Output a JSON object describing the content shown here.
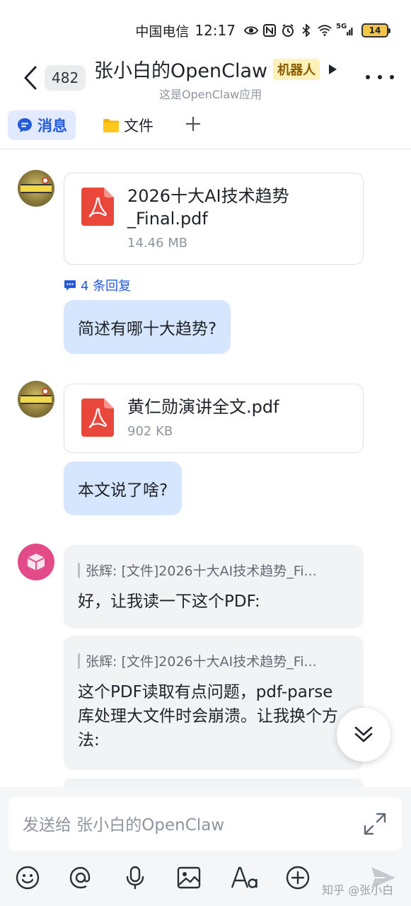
{
  "status_bar": {
    "carrier": "中国电信",
    "time": "12:17",
    "battery": "14",
    "network": "5G",
    "icons": [
      "eye-icon",
      "nfc-icon",
      "alarm-icon",
      "bluetooth-icon",
      "wifi-icon",
      "signal-icon",
      "battery-icon"
    ]
  },
  "header": {
    "unread_count": "482",
    "title": "张小白的OpenClaw",
    "badge": "机器人",
    "subtitle": "这是OpenClaw应用"
  },
  "tabs": [
    {
      "label": "消息",
      "icon": "chat-bubble-icon",
      "active": true
    },
    {
      "label": "文件",
      "icon": "folder-icon",
      "active": false
    }
  ],
  "messages": {
    "file1": {
      "name": "2026十大AI技术趋势_Final.pdf",
      "size": "14.46 MB"
    },
    "reply_count": "4 条回复",
    "question1": "简述有哪十大趋势?",
    "file2": {
      "name": "黄仁勋演讲全文.pdf",
      "size": "902 KB"
    },
    "question2": "本文说了啥?",
    "bot_reply1": {
      "quote": "张辉: [文件]2026十大AI技术趋势_Fi...",
      "text": "好，让我读一下这个PDF:"
    },
    "bot_reply2": {
      "quote": "张辉: [文件]2026十大AI技术趋势_Fi...",
      "text": "这个PDF读取有点问题，pdf-parse库处理大文件时会崩溃。让我换个方法:"
    }
  },
  "input": {
    "placeholder": "发送给 张小白的OpenClaw"
  },
  "toolbar": {
    "icons": [
      "emoji-icon",
      "mention-icon",
      "microphone-icon",
      "image-icon",
      "text-format-icon",
      "plus-circle-icon",
      "send-icon"
    ]
  },
  "watermark": "知乎 @张小白",
  "colors": {
    "accent": "#245bdb",
    "bubble_blue": "#d6e6ff",
    "bubble_grey": "#f2f3f5",
    "pdf_red": "#e9463c",
    "badge_bg": "#fdf0b9"
  }
}
